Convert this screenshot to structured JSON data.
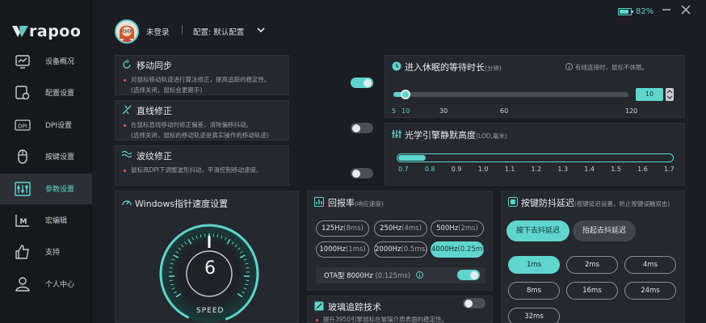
{
  "brand": {
    "logo_text": "rapoo"
  },
  "battery": {
    "percent_text": "82%",
    "level": 0.82
  },
  "sidebar": {
    "items": [
      {
        "label": "设备概况",
        "icon": "chart-monitor-icon"
      },
      {
        "label": "配置设置",
        "icon": "config-icon"
      },
      {
        "label": "DPI设置",
        "icon": "dpi-icon"
      },
      {
        "label": "按键设置",
        "icon": "mouse-icon"
      },
      {
        "label": "参数设置",
        "icon": "sliders-icon",
        "active": true
      },
      {
        "label": "宏编辑",
        "icon": "macro-icon"
      },
      {
        "label": "支持",
        "icon": "thumbs-up-icon"
      },
      {
        "label": "个人中心",
        "icon": "user-icon"
      }
    ]
  },
  "header": {
    "login_text": "未登录",
    "config_text": "配置: 默认配置"
  },
  "motion_sync": {
    "title": "移动同步",
    "desc1": "对鼠标移动轨迹进行算法修正，提高追踪的稳定性。",
    "desc2": "(选择关闭，鼠标会更跟手)",
    "enabled": true
  },
  "straight_line": {
    "title": "直线修正",
    "desc1": "在鼠标直线移动时修正偏差，清除偏移抖动。",
    "desc2": "(选择关闭，鼠标的移动轨迹是真实操作的移动轨迹)",
    "enabled": false
  },
  "ripple": {
    "title": "波纹修正",
    "desc1": "鼠标高DPI下调整波形抖动，平滑控制移动速度。",
    "enabled": false
  },
  "sleep": {
    "title": "进入休眠的等待时长",
    "unit": "(分钟)",
    "note": "有线连接时，鼠标不休眠。",
    "value": "10",
    "ticks": [
      "5",
      "10",
      "30",
      "60",
      "120"
    ],
    "level": 0.05
  },
  "lod": {
    "title": "光学引擎静默高度",
    "unit": "(LOD,毫米)",
    "ticks": [
      "0.7",
      "0.8",
      "0.9",
      "1.0",
      "1.1",
      "1.2",
      "1.3",
      "1.4",
      "1.5",
      "1.6",
      "1.7"
    ],
    "selected_index": 1
  },
  "pointer_speed": {
    "title": "Windows指针速度设置",
    "value": "6",
    "speed_label": "SPEED"
  },
  "report_rate": {
    "title": "回报率",
    "unit": "(响应速度)",
    "options": [
      {
        "main": "125Hz",
        "sub": "(8ms)"
      },
      {
        "main": "250Hz",
        "sub": "(4ms)"
      },
      {
        "main": "500Hz",
        "sub": "(2ms)"
      },
      {
        "main": "1000Hz",
        "sub": "(1ms)"
      },
      {
        "main": "2000Hz",
        "sub": "(0.5ms)"
      },
      {
        "main": "4000Hz",
        "sub": "(0.25ms)",
        "selected": true
      }
    ],
    "ota_main": "OTA型 8000Hz",
    "ota_sub": "(0.125ms)",
    "ota_enabled": true
  },
  "glass": {
    "title": "玻璃追踪技术",
    "desc1": "提升3950引擎鼠标在玻璃介质表面的稳定性。"
  },
  "debounce": {
    "title": "按键防抖延迟",
    "note": "(按键延迟设置，防止按键误触双击)",
    "tab_press": "按下去抖延迟",
    "tab_release": "抬起去抖延迟",
    "options": [
      "1ms",
      "2ms",
      "4ms",
      "8ms",
      "16ms",
      "24ms",
      "32ms"
    ],
    "selected_index": 0
  },
  "colors": {
    "accent": "#5fd5cd",
    "bg": "#1b1d22",
    "card": "#25282e",
    "danger": "#e0574e"
  }
}
